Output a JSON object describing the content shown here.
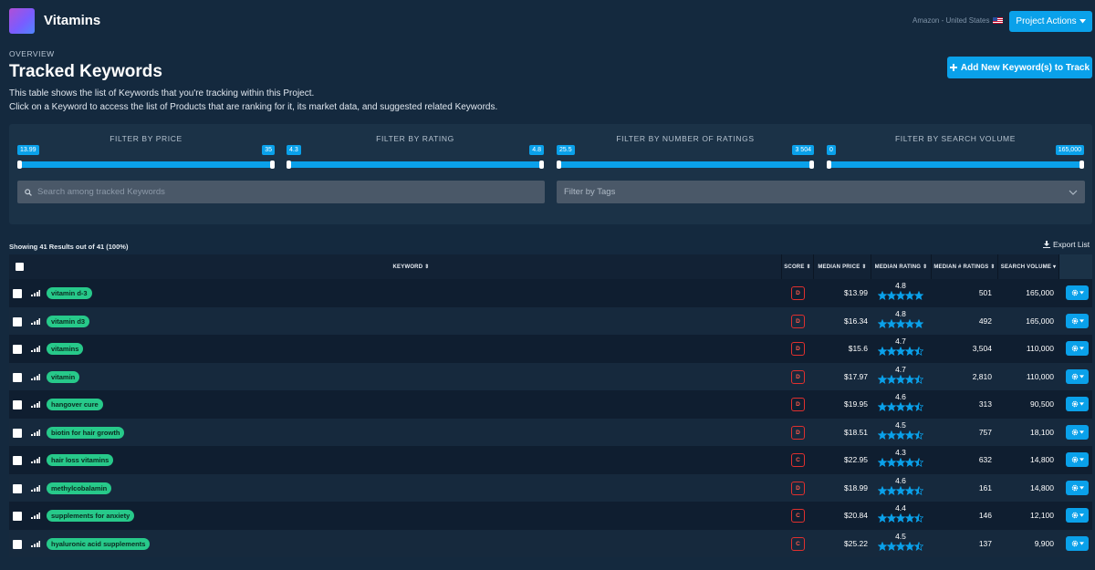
{
  "header": {
    "app_title": "Vitamins",
    "marketplace": "Amazon - United States",
    "project_actions_label": "Project Actions",
    "accent": "#0aa1ea"
  },
  "intro": {
    "overview": "OVERVIEW",
    "title": "Tracked Keywords",
    "line1": "This table shows the list of Keywords that you're tracking within this Project.",
    "line2": "Click on a Keyword to access the list of Products that are ranking for it, its market data, and suggested related Keywords.",
    "add_button_label": "Add New Keyword(s) to Track"
  },
  "filters": {
    "items": [
      {
        "label": "FILTER BY PRICE",
        "min": "13.99",
        "max": "35"
      },
      {
        "label": "FILTER BY RATING",
        "min": "4.3",
        "max": "4.8"
      },
      {
        "label": "FILTER BY NUMBER OF RATINGS",
        "min": "25.5",
        "max": "3 504"
      },
      {
        "label": "FILTER BY SEARCH VOLUME",
        "min": "0",
        "max": "165,000"
      }
    ],
    "search_placeholder": "Search among tracked Keywords",
    "tags_placeholder": "Filter by Tags"
  },
  "results": {
    "showing": "Showing 41 Results out of 41 (100%)",
    "export_label": "Export List"
  },
  "table": {
    "headers": {
      "keyword": "KEYWORD",
      "score": "SCORE",
      "median_price": "MEDIAN PRICE",
      "median_rating": "MEDIAN RATING",
      "median_ratings": "MEDIAN # RATINGS",
      "search_volume": "SEARCH VOLUME"
    },
    "rows": [
      {
        "keyword": "vitamin d-3",
        "score": "D",
        "price": "$13.99",
        "rating": "4.8",
        "ratings": "501",
        "volume": "165,000"
      },
      {
        "keyword": "vitamin d3",
        "score": "D",
        "price": "$16.34",
        "rating": "4.8",
        "ratings": "492",
        "volume": "165,000"
      },
      {
        "keyword": "vitamins",
        "score": "D",
        "price": "$15.6",
        "rating": "4.7",
        "ratings": "3,504",
        "volume": "110,000"
      },
      {
        "keyword": "vitamin",
        "score": "D",
        "price": "$17.97",
        "rating": "4.7",
        "ratings": "2,810",
        "volume": "110,000"
      },
      {
        "keyword": "hangover cure",
        "score": "D",
        "price": "$19.95",
        "rating": "4.6",
        "ratings": "313",
        "volume": "90,500"
      },
      {
        "keyword": "biotin for hair growth",
        "score": "D",
        "price": "$18.51",
        "rating": "4.5",
        "ratings": "757",
        "volume": "18,100"
      },
      {
        "keyword": "hair loss vitamins",
        "score": "C",
        "price": "$22.95",
        "rating": "4.3",
        "ratings": "632",
        "volume": "14,800"
      },
      {
        "keyword": "methylcobalamin",
        "score": "D",
        "price": "$18.99",
        "rating": "4.6",
        "ratings": "161",
        "volume": "14,800"
      },
      {
        "keyword": "supplements for anxiety",
        "score": "C",
        "price": "$20.84",
        "rating": "4.4",
        "ratings": "146",
        "volume": "12,100"
      },
      {
        "keyword": "hyaluronic acid supplements",
        "score": "C",
        "price": "$25.22",
        "rating": "4.5",
        "ratings": "137",
        "volume": "9,900"
      }
    ]
  }
}
